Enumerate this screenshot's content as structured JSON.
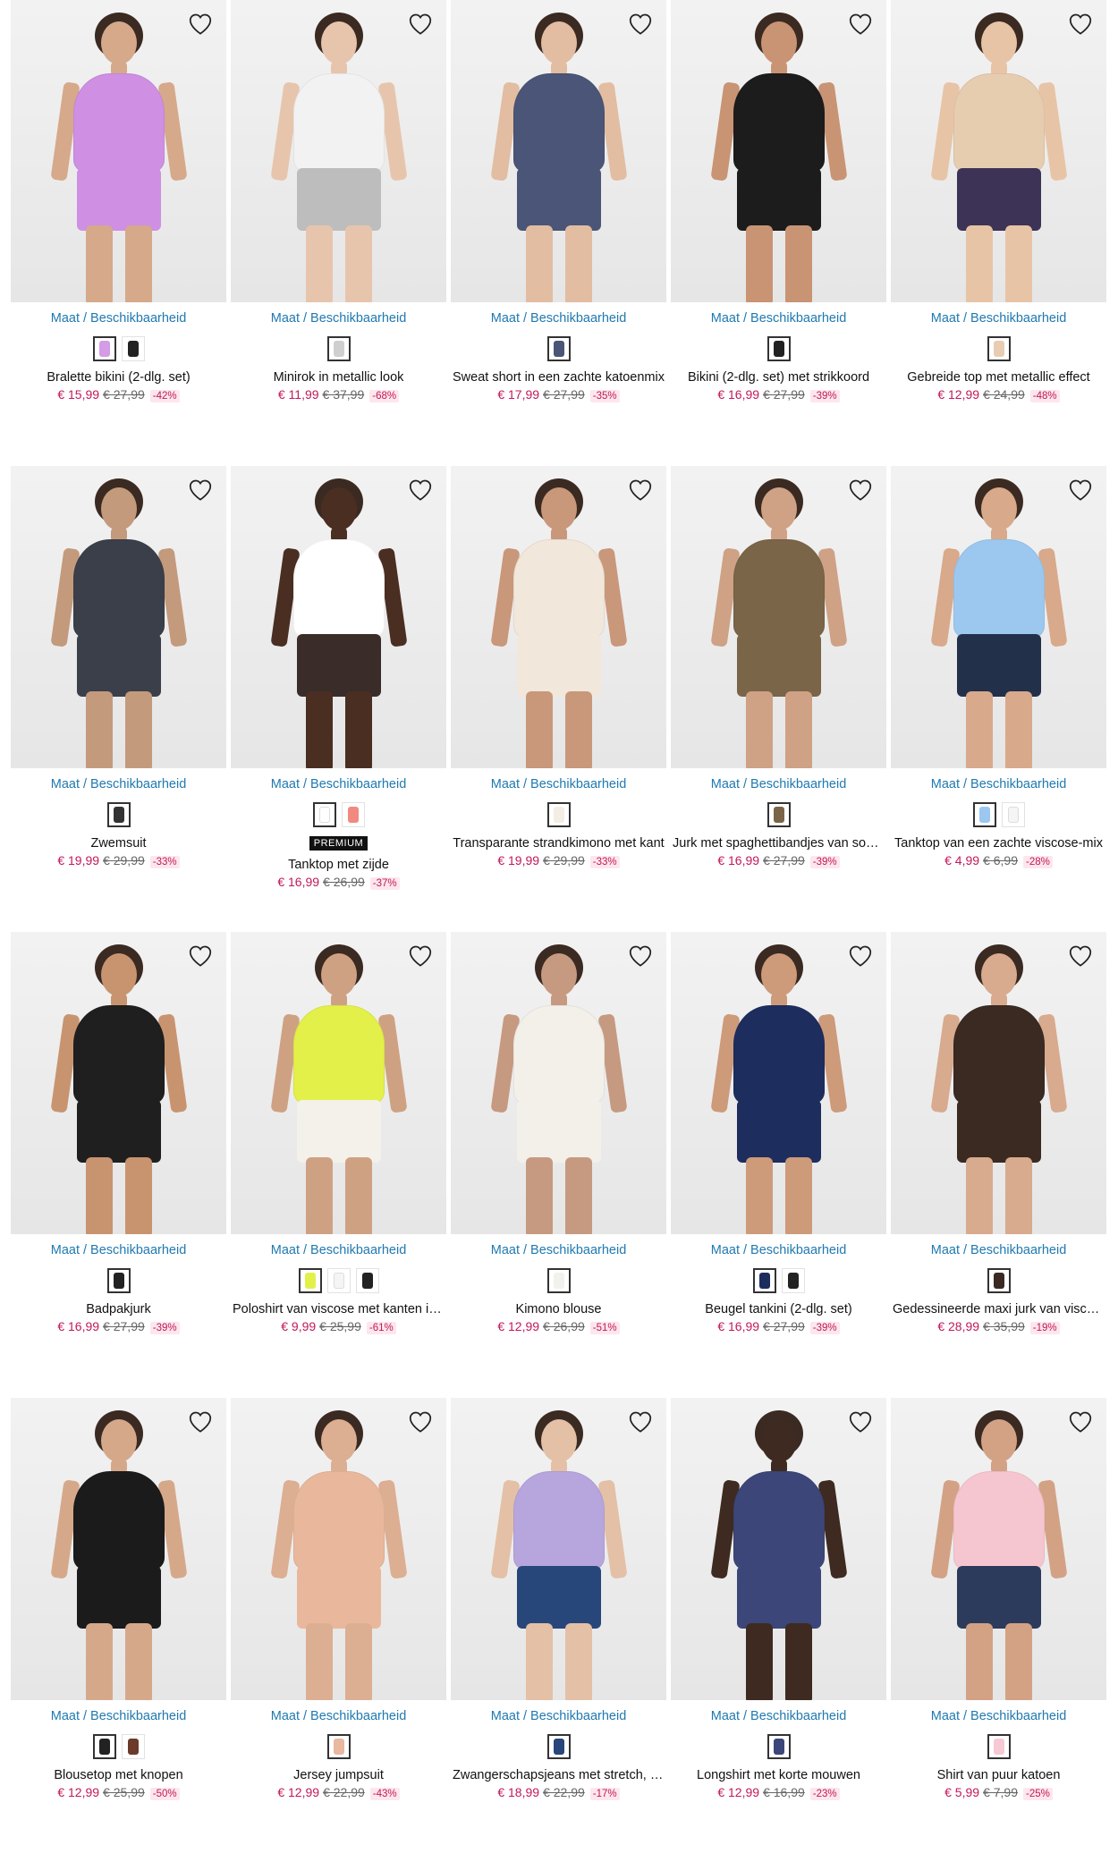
{
  "size_label": "Maat / Beschikbaarheid",
  "products": [
    {
      "name": "Bralette bikini (2-dlg. set)",
      "price": "€ 15,99",
      "old": "€ 27,99",
      "discount": "-42%",
      "swatches": [
        "#d49be6",
        "#222222"
      ],
      "tone": "#d5a98a",
      "top": "#cf8fe3",
      "bottom": "#cf8fe3",
      "badge": ""
    },
    {
      "name": "Minirok in metallic look",
      "price": "€ 11,99",
      "old": "€ 37,99",
      "discount": "-68%",
      "swatches": [
        "#cfcfcf"
      ],
      "tone": "#e7c5ad",
      "top": "#f2f2f2",
      "bottom": "#bdbdbd",
      "badge": ""
    },
    {
      "name": "Sweat short in een zachte katoenmix",
      "price": "€ 17,99",
      "old": "€ 27,99",
      "discount": "-35%",
      "swatches": [
        "#4a5577"
      ],
      "tone": "#e2bda2",
      "top": "#4a5577",
      "bottom": "#4a5577",
      "badge": ""
    },
    {
      "name": "Bikini (2-dlg. set) met strikkoord",
      "price": "€ 16,99",
      "old": "€ 27,99",
      "discount": "-39%",
      "swatches": [
        "#222222"
      ],
      "tone": "#c99474",
      "top": "#1c1c1c",
      "bottom": "#1c1c1c",
      "badge": ""
    },
    {
      "name": "Gebreide top met metallic effect",
      "price": "€ 12,99",
      "old": "€ 24,99",
      "discount": "-48%",
      "swatches": [
        "#e8cdb2"
      ],
      "tone": "#e8c4a6",
      "top": "#e6cdb0",
      "bottom": "#3d3356",
      "badge": ""
    },
    {
      "name": "Zwemsuit",
      "price": "€ 19,99",
      "old": "€ 29,99",
      "discount": "-33%",
      "swatches": [
        "#333333"
      ],
      "tone": "#c49a7c",
      "top": "#3b3f4a",
      "bottom": "#3b3f4a",
      "badge": ""
    },
    {
      "name": "Tanktop met zijde",
      "price": "€ 16,99",
      "old": "€ 26,99",
      "discount": "-37%",
      "swatches": [
        "#ffffff",
        "#f08a80"
      ],
      "tone": "#4a2e22",
      "top": "#ffffff",
      "bottom": "#3a2c28",
      "badge": "PREMIUM"
    },
    {
      "name": "Transparante strandkimono met kant",
      "price": "€ 19,99",
      "old": "€ 29,99",
      "discount": "-33%",
      "swatches": [
        "#f4ede4"
      ],
      "tone": "#c9977a",
      "top": "#f1e7db",
      "bottom": "#f1e7db",
      "badge": ""
    },
    {
      "name": "Jurk met spaghettibandjes van soepel vallende viscose",
      "price": "€ 16,99",
      "old": "€ 27,99",
      "discount": "-39%",
      "swatches": [
        "#7a6548"
      ],
      "tone": "#cfa185",
      "top": "#7a6548",
      "bottom": "#7a6548",
      "badge": ""
    },
    {
      "name": "Tanktop van een zachte viscose-mix",
      "price": "€ 4,99",
      "old": "€ 6,99",
      "discount": "-28%",
      "swatches": [
        "#9cc8f0",
        "#f5f5f5"
      ],
      "tone": "#d8a98a",
      "top": "#9cc8f0",
      "bottom": "#23304a",
      "badge": ""
    },
    {
      "name": "Badpakjurk",
      "price": "€ 16,99",
      "old": "€ 27,99",
      "discount": "-39%",
      "swatches": [
        "#222222"
      ],
      "tone": "#c8946f",
      "top": "#1f1f1f",
      "bottom": "#1f1f1f",
      "badge": ""
    },
    {
      "name": "Poloshirt van viscose met kanten inzet",
      "price": "€ 9,99",
      "old": "€ 25,99",
      "discount": "-61%",
      "swatches": [
        "#e4f04a",
        "#f5f5f5",
        "#222222"
      ],
      "tone": "#cfa183",
      "top": "#e4f04a",
      "bottom": "#f3f1ea",
      "badge": ""
    },
    {
      "name": "Kimono blouse",
      "price": "€ 12,99",
      "old": "€ 26,99",
      "discount": "-51%",
      "swatches": [
        "#f3f1ed"
      ],
      "tone": "#c69a80",
      "top": "#f3f0ea",
      "bottom": "#f3f0ea",
      "badge": ""
    },
    {
      "name": "Beugel tankini (2-dlg. set)",
      "price": "€ 16,99",
      "old": "€ 27,99",
      "discount": "-39%",
      "swatches": [
        "#1d2d5e",
        "#222222"
      ],
      "tone": "#cd9a7a",
      "top": "#1d2d5e",
      "bottom": "#1d2d5e",
      "badge": ""
    },
    {
      "name": "Gedessineerde maxi jurk van viscose",
      "price": "€ 28,99",
      "old": "€ 35,99",
      "discount": "-19%",
      "swatches": [
        "#3a2a22"
      ],
      "tone": "#d8aa8e",
      "top": "#3a2a22",
      "bottom": "#3a2a22",
      "badge": ""
    },
    {
      "name": "Blousetop met knopen",
      "price": "€ 12,99",
      "old": "€ 25,99",
      "discount": "-50%",
      "swatches": [
        "#222222",
        "#6b3a2a"
      ],
      "tone": "#d6a88a",
      "top": "#1b1b1b",
      "bottom": "#1b1b1b",
      "badge": ""
    },
    {
      "name": "Jersey jumpsuit",
      "price": "€ 12,99",
      "old": "€ 22,99",
      "discount": "-43%",
      "swatches": [
        "#e8b8a0"
      ],
      "tone": "#dcae92",
      "top": "#e9b89c",
      "bottom": "#e9b89c",
      "badge": ""
    },
    {
      "name": "Zwangerschapsjeans met stretch, straight",
      "price": "€ 18,99",
      "old": "€ 22,99",
      "discount": "-17%",
      "swatches": [
        "#27477a"
      ],
      "tone": "#e3c0a6",
      "top": "#b7a5dd",
      "bottom": "#27477a",
      "badge": ""
    },
    {
      "name": "Longshirt met korte mouwen",
      "price": "€ 12,99",
      "old": "€ 16,99",
      "discount": "-23%",
      "swatches": [
        "#3c4678"
      ],
      "tone": "#3e2a20",
      "top": "#3c4678",
      "bottom": "#3c4678",
      "badge": ""
    },
    {
      "name": "Shirt van puur katoen",
      "price": "€ 5,99",
      "old": "€ 7,99",
      "discount": "-25%",
      "swatches": [
        "#f6c9d3"
      ],
      "tone": "#d3a285",
      "top": "#f6c6d0",
      "bottom": "#2c3b5c",
      "badge": ""
    }
  ]
}
